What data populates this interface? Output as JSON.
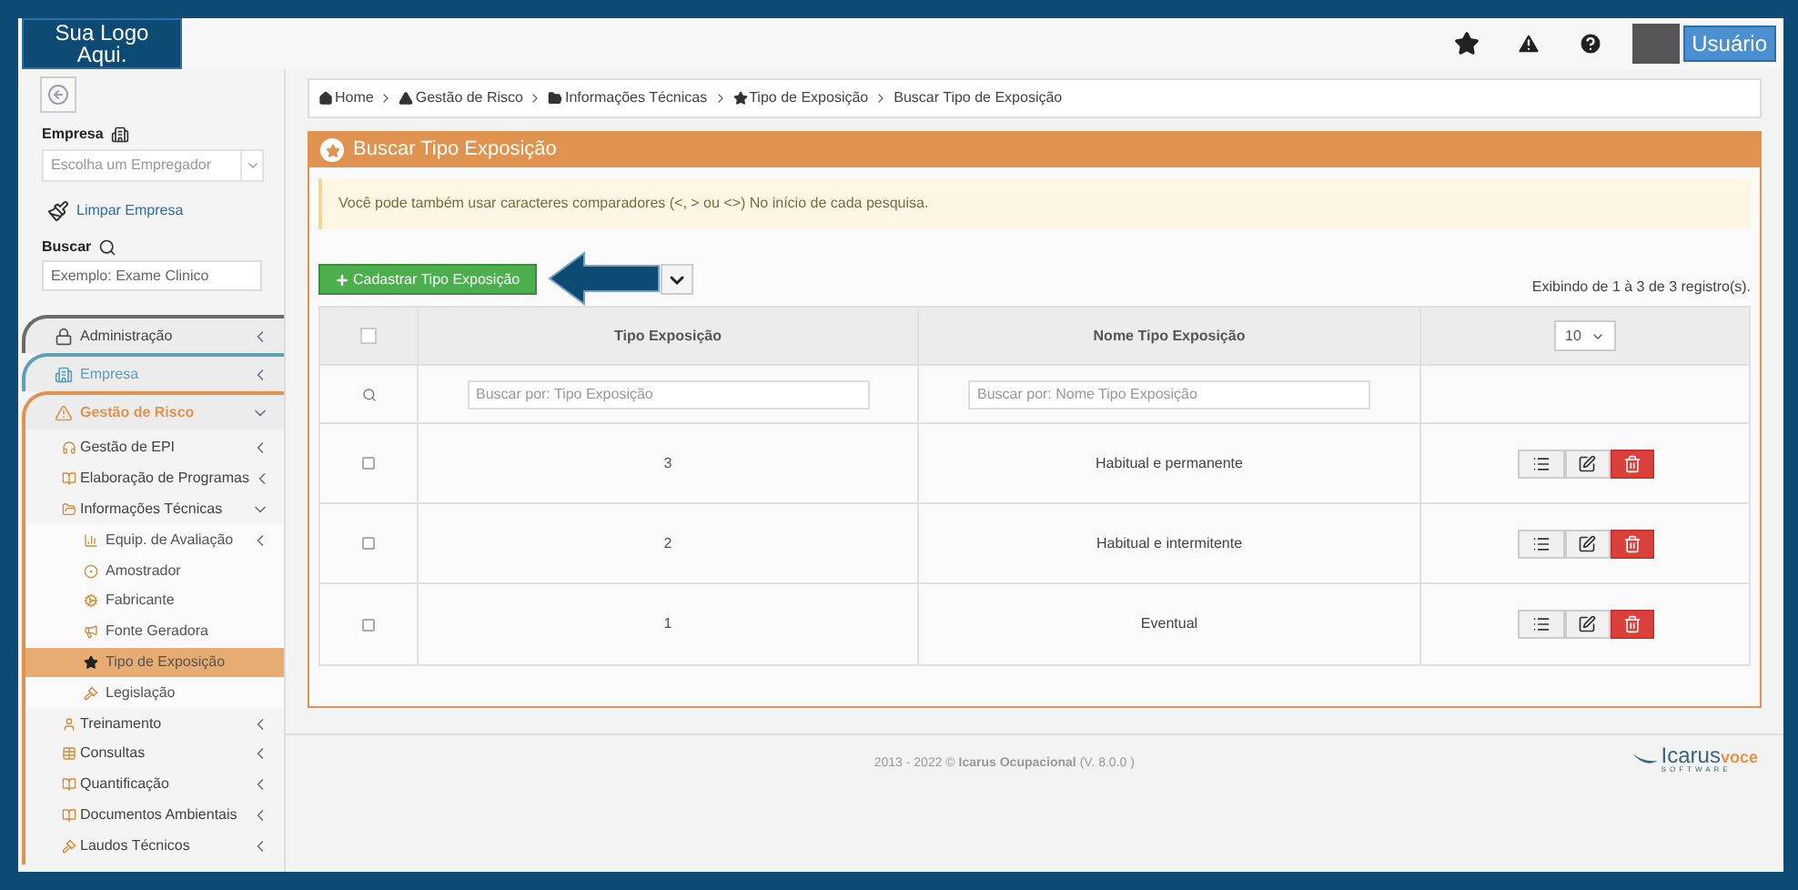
{
  "logo": {
    "text": "Sua Logo Aqui."
  },
  "header": {
    "user_button": "Usuário"
  },
  "sidebar": {
    "empresa_label": "Empresa",
    "empresa_select": {
      "placeholder": "Escolha um Empregador"
    },
    "clear_link": "Limpar Empresa",
    "search_label": "Buscar",
    "search": {
      "placeholder": "Exemplo: Exame Clinico"
    },
    "sections": [
      {
        "label": "Administração",
        "color": "#6b6b6b",
        "expanded": false
      },
      {
        "label": "Empresa",
        "color": "#5e9fb8",
        "expanded": false
      },
      {
        "label": "Gestão de Risco",
        "color": "#e0934f",
        "expanded": true,
        "children": [
          {
            "label": "Gestão de EPI",
            "expanded": false,
            "selected": false
          },
          {
            "label": "Elaboração de Programas",
            "expanded": false,
            "selected": false
          },
          {
            "label": "Informações Técnicas",
            "expanded": true,
            "selected": false,
            "children": [
              {
                "label": "Equip. de Avaliação",
                "expanded": false,
                "selected": false
              },
              {
                "label": "Amostrador",
                "selected": false
              },
              {
                "label": "Fabricante",
                "selected": false
              },
              {
                "label": "Fonte Geradora",
                "selected": false
              },
              {
                "label": "Tipo de Exposição",
                "selected": true
              },
              {
                "label": "Legislação",
                "selected": false
              }
            ]
          },
          {
            "label": "Treinamento",
            "expanded": false,
            "selected": false
          },
          {
            "label": "Consultas",
            "expanded": false,
            "selected": false
          },
          {
            "label": "Quantificação",
            "expanded": false,
            "selected": false
          },
          {
            "label": "Documentos Ambientais",
            "expanded": false,
            "selected": false
          },
          {
            "label": "Laudos Técnicos",
            "expanded": false,
            "selected": false
          }
        ]
      }
    ]
  },
  "breadcrumb": [
    "Home",
    "Gestão de Risco",
    "Informações Técnicas",
    "Tipo de Exposição",
    "Buscar Tipo de Exposição"
  ],
  "panel": {
    "title": "Buscar Tipo Exposição",
    "alert": "Você pode também usar caracteres comparadores (<, > ou <>) No início de cada pesquisa.",
    "create_button": "Cadastrar Tipo Exposição",
    "records": "Exibindo de 1 à 3 de 3 registro(s).",
    "table": {
      "columns": [
        "Tipo Exposição",
        "Nome Tipo Exposição"
      ],
      "page_size": "10",
      "select_all": {
        "checked": false
      },
      "filters": [
        {
          "placeholder": "Buscar por: Tipo Exposição"
        },
        {
          "placeholder": "Buscar por: Nome Tipo Exposição"
        }
      ],
      "rows": [
        {
          "checked": false,
          "code": "3",
          "name": "Habitual e permanente"
        },
        {
          "checked": false,
          "code": "2",
          "name": "Habitual e intermitente"
        },
        {
          "checked": false,
          "code": "1",
          "name": "Eventual"
        }
      ]
    }
  },
  "footer": {
    "text": "2013 - 2022 © **Icarus Ocupacional** (V. 8.0.0 )",
    "brand": "Icarus",
    "brand_suffix": "voce",
    "brand_sub": "SOFTWARE"
  }
}
